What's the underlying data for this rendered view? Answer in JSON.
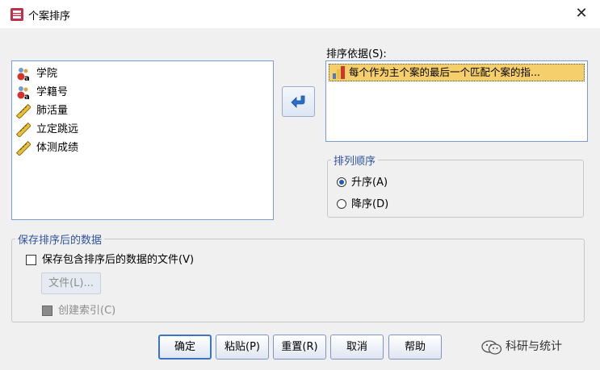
{
  "window": {
    "title": "个案排序",
    "close_glyph": "✕"
  },
  "source_variables": [
    {
      "label": "学院",
      "icon": "nominal-string-icon"
    },
    {
      "label": "学籍号",
      "icon": "nominal-string-icon"
    },
    {
      "label": "肺活量",
      "icon": "scale-ruler-icon"
    },
    {
      "label": "立定跳远",
      "icon": "scale-ruler-icon"
    },
    {
      "label": "体测成绩",
      "icon": "scale-ruler-icon"
    }
  ],
  "sort_by": {
    "label": "排序依据(S):",
    "items": [
      {
        "label": "每个作为主个案的最后一个匹配个案的指...",
        "icon": "indicator-bar-icon"
      }
    ]
  },
  "order": {
    "legend": "排列顺序",
    "ascending": {
      "label": "升序(A)",
      "selected": true
    },
    "descending": {
      "label": "降序(D)",
      "selected": false
    }
  },
  "save": {
    "legend": "保存排序后的数据",
    "save_checkbox": {
      "label": "保存包含排序后的数据的文件(V)",
      "checked": false
    },
    "file_button": "文件(L)...",
    "index_checkbox": {
      "label": "创建索引(C)",
      "checked": false,
      "disabled": true
    }
  },
  "buttons": {
    "ok": "确定",
    "paste": "粘贴(P)",
    "reset": "重置(R)",
    "cancel": "取消",
    "help": "帮助"
  },
  "watermark": {
    "text": "科研与统计",
    "icon": "wechat-icon"
  },
  "colors": {
    "accent": "#2f52a0",
    "selection": "#f5cf6b",
    "border": "#7a9cd3"
  }
}
